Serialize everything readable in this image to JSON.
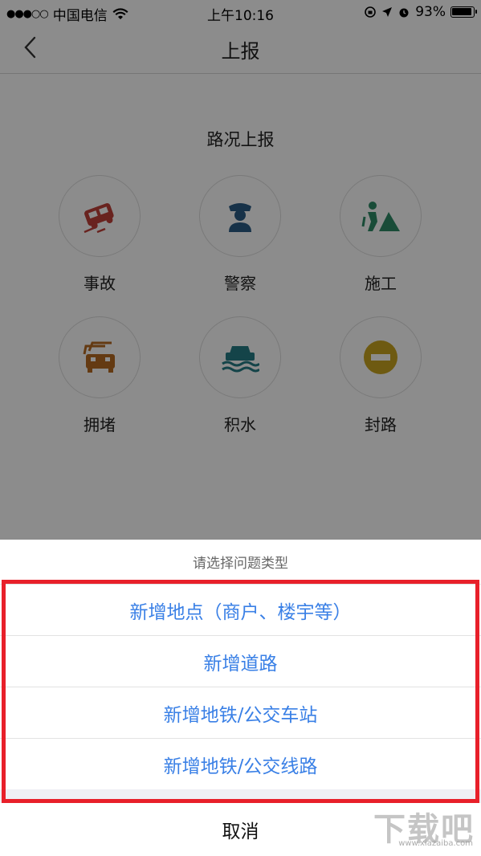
{
  "status_bar": {
    "signal": "●●●○○",
    "carrier": "中国电信",
    "time": "上午10:16",
    "battery": "93%"
  },
  "nav": {
    "title": "上报"
  },
  "section_title": "路况上报",
  "categories": [
    {
      "label": "事故",
      "icon": "car-crash-icon",
      "color": "#c0413a"
    },
    {
      "label": "警察",
      "icon": "police-icon",
      "color": "#2a5b86"
    },
    {
      "label": "施工",
      "icon": "construction-icon",
      "color": "#2f8a67"
    },
    {
      "label": "拥堵",
      "icon": "traffic-jam-icon",
      "color": "#b76a21"
    },
    {
      "label": "积水",
      "icon": "flood-icon",
      "color": "#267c86"
    },
    {
      "label": "封路",
      "icon": "road-closed-icon",
      "color": "#c8a420"
    }
  ],
  "sheet": {
    "header": "请选择问题类型",
    "options": [
      {
        "label": "新增地点（商户、楼宇等）"
      },
      {
        "label": "新增道路"
      },
      {
        "label": "新增地铁/公交车站"
      },
      {
        "label": "新增地铁/公交线路"
      }
    ],
    "cancel": "取消"
  },
  "watermark": {
    "main": "下载吧",
    "sub": "www.xiazaiba.com"
  },
  "colors": {
    "accent": "#3a80e6",
    "highlight": "#e8202a"
  }
}
